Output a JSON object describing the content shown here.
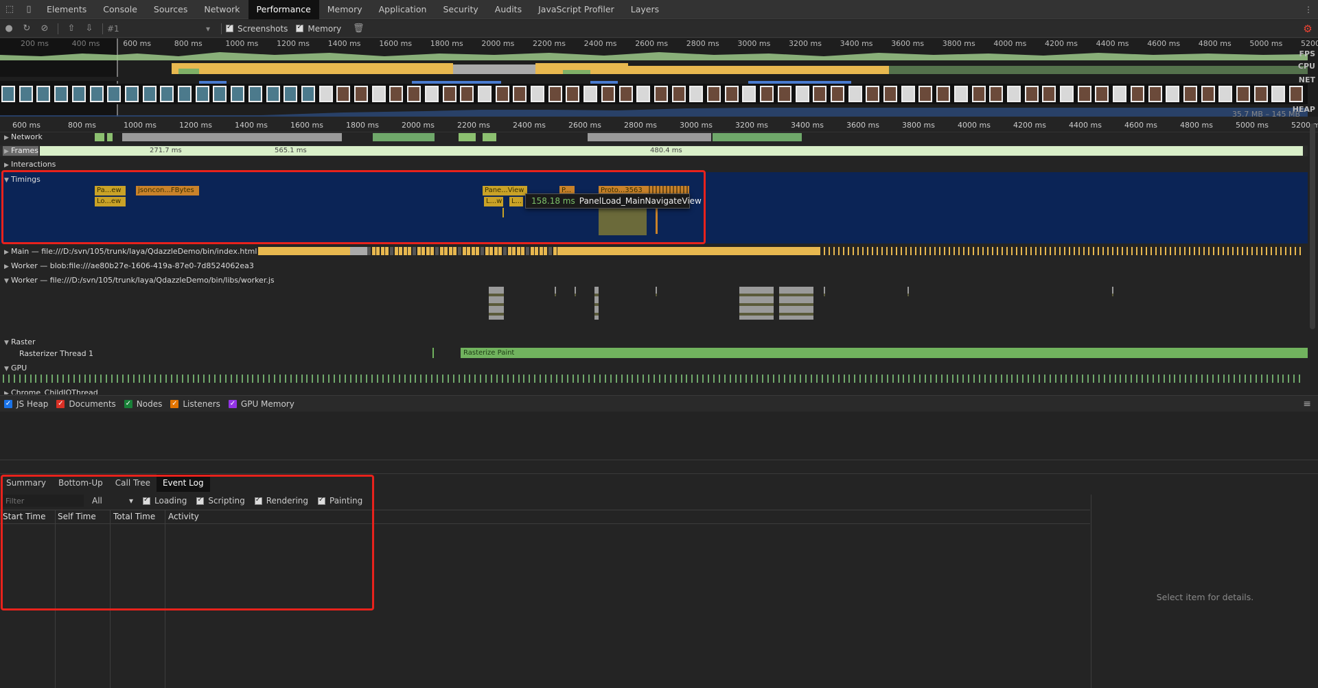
{
  "tabs": [
    "Elements",
    "Console",
    "Sources",
    "Network",
    "Performance",
    "Memory",
    "Application",
    "Security",
    "Audits",
    "JavaScript Profiler",
    "Layers"
  ],
  "active_tab": "Performance",
  "toolbar": {
    "recording_select": "#1",
    "screenshots_label": "Screenshots",
    "memory_label": "Memory"
  },
  "overview": {
    "ticks": [
      "200 ms",
      "400 ms",
      "600 ms",
      "800 ms",
      "1000 ms",
      "1200 ms",
      "1400 ms",
      "1600 ms",
      "1800 ms",
      "2000 ms",
      "2200 ms",
      "2400 ms",
      "2600 ms",
      "2800 ms",
      "3000 ms",
      "3200 ms",
      "3400 ms",
      "3600 ms",
      "3800 ms",
      "4000 ms",
      "4200 ms",
      "4400 ms",
      "4600 ms",
      "4800 ms",
      "5000 ms",
      "5200 ms"
    ],
    "fps_label": "FPS",
    "cpu_label": "CPU",
    "net_label": "NET",
    "heap_label": "HEAP",
    "heap_range": "35.7 MB – 145 MB"
  },
  "main_ruler": [
    "600 ms",
    "800 ms",
    "1000 ms",
    "1200 ms",
    "1400 ms",
    "1600 ms",
    "1800 ms",
    "2000 ms",
    "2200 ms",
    "2400 ms",
    "2600 ms",
    "2800 ms",
    "3000 ms",
    "3200 ms",
    "3400 ms",
    "3600 ms",
    "3800 ms",
    "4000 ms",
    "4200 ms",
    "4400 ms",
    "4600 ms",
    "4800 ms",
    "5000 ms",
    "5200 ms"
  ],
  "tracks": {
    "network": "Network",
    "frames": "Frames",
    "frame_times": [
      "271.7 ms",
      "565.1 ms",
      "480.4 ms"
    ],
    "interactions": "Interactions",
    "timings": "Timings",
    "main": "Main — file:///D:/svn/105/trunk/laya/QdazzleDemo/bin/index.html",
    "worker1": "Worker — blob:file:///ae80b27e-1606-419a-87e0-7d8524062ea3",
    "worker2": "Worker — file:///D:/svn/105/trunk/laya/QdazzleDemo/bin/libs/worker.js",
    "raster": "Raster",
    "rasterizer": "Rasterizer Thread 1",
    "rasterize_paint": "Rasterize Paint",
    "gpu": "GPU",
    "chrome_child": "Chrome_ChildIOThread"
  },
  "timing_marks": [
    "Pa...ew",
    "Lo...ew",
    "jsoncon...FBytes",
    "Pane...View",
    "L...w",
    "L...",
    "P...",
    "Proto...3563"
  ],
  "tooltip": {
    "duration": "158.18 ms",
    "name": "PanelLoad_MainNavigateView"
  },
  "counters": [
    {
      "label": "JS Heap",
      "color": "#1a73e8"
    },
    {
      "label": "Documents",
      "color": "#d93025"
    },
    {
      "label": "Nodes",
      "color": "#188038"
    },
    {
      "label": "Listeners",
      "color": "#e37400"
    },
    {
      "label": "GPU Memory",
      "color": "#9334e6"
    }
  ],
  "bottom_tabs": [
    "Summary",
    "Bottom-Up",
    "Call Tree",
    "Event Log"
  ],
  "bottom_active": "Event Log",
  "filter": {
    "placeholder": "Filter",
    "duration": "All",
    "checks": [
      "Loading",
      "Scripting",
      "Rendering",
      "Painting"
    ]
  },
  "columns": [
    "Start Time",
    "Self Time",
    "Total Time",
    "Activity"
  ],
  "details_placeholder": "Select item for details."
}
